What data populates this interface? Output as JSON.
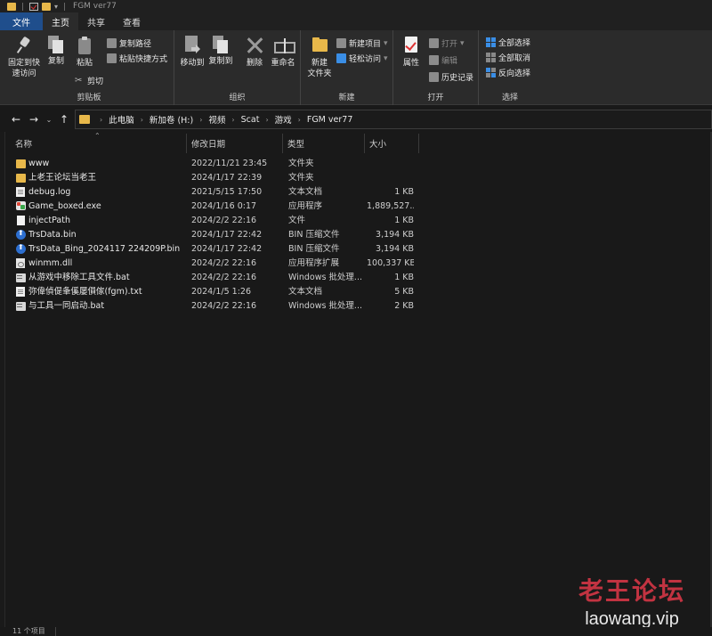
{
  "titlebar": {
    "title": "FGM ver77",
    "dropdown": "▾"
  },
  "tabs": [
    "文件",
    "主页",
    "共享",
    "查看"
  ],
  "ribbon": {
    "clipboard": {
      "label": "剪贴板",
      "pin": "固定到快\n速访问",
      "copy": "复制",
      "paste": "粘贴",
      "copy_path": "复制路径",
      "paste_shortcut": "粘贴快捷方式",
      "cut": "剪切"
    },
    "organize": {
      "label": "组织",
      "move_to": "移动到",
      "copy_to": "复制到",
      "delete": "删除",
      "rename": "重命名"
    },
    "new": {
      "label": "新建",
      "new_folder": "新建\n文件夹",
      "new_item": "新建项目",
      "easy_access": "轻松访问"
    },
    "open": {
      "label": "打开",
      "properties": "属性",
      "open": "打开",
      "edit": "编辑",
      "history": "历史记录"
    },
    "select": {
      "label": "选择",
      "select_all": "全部选择",
      "select_none": "全部取消",
      "invert": "反向选择"
    }
  },
  "nav": {
    "back": "←",
    "forward": "→",
    "recent": "⌄",
    "up": "↑",
    "breadcrumb": [
      "此电脑",
      "新加卷 (H:)",
      "视频",
      "Scat",
      "游戏",
      "FGM ver77"
    ]
  },
  "columns": {
    "name": "名称",
    "date": "修改日期",
    "type": "类型",
    "size": "大小"
  },
  "files": [
    {
      "name": "www",
      "date": "2022/11/21 23:45",
      "type": "文件夹",
      "size": "",
      "icon": "folder"
    },
    {
      "name": "上老王论坛当老王",
      "date": "2024/1/17 22:39",
      "type": "文件夹",
      "size": "",
      "icon": "folder"
    },
    {
      "name": "debug.log",
      "date": "2021/5/15 17:50",
      "type": "文本文档",
      "size": "1 KB",
      "icon": "txt"
    },
    {
      "name": "Game_boxed.exe",
      "date": "2024/1/16 0:17",
      "type": "应用程序",
      "size": "1,889,527...",
      "icon": "exe"
    },
    {
      "name": "injectPath",
      "date": "2024/2/2 22:16",
      "type": "文件",
      "size": "1 KB",
      "icon": "file"
    },
    {
      "name": "TrsData.bin",
      "date": "2024/1/17 22:42",
      "type": "BIN 压缩文件",
      "size": "3,194 KB",
      "icon": "bin"
    },
    {
      "name": "TrsData_Bing_2024117 224209P.bin",
      "date": "2024/1/17 22:42",
      "type": "BIN 压缩文件",
      "size": "3,194 KB",
      "icon": "bin"
    },
    {
      "name": "winmm.dll",
      "date": "2024/2/2 22:16",
      "type": "应用程序扩展",
      "size": "100,337 KB",
      "icon": "dll"
    },
    {
      "name": "从游戏中移除工具文件.bat",
      "date": "2024/2/2 22:16",
      "type": "Windows 批处理...",
      "size": "1 KB",
      "icon": "bat"
    },
    {
      "name": "弥偉偵偍夆傒屡傊傢(fgm).txt",
      "date": "2024/1/5 1:26",
      "type": "文本文档",
      "size": "5 KB",
      "icon": "txt"
    },
    {
      "name": "与工具一同启动.bat",
      "date": "2024/2/2 22:16",
      "type": "Windows 批处理...",
      "size": "2 KB",
      "icon": "bat"
    }
  ],
  "status": {
    "count": "11 个项目"
  },
  "watermark": {
    "cn": "老王论坛",
    "url": "laowang.vip"
  },
  "colors": {
    "accent": "#1f4e8c",
    "folder": "#e8b84a",
    "background": "#191919",
    "ribbon": "#2b2b2b",
    "watermark": "#e8394a"
  }
}
